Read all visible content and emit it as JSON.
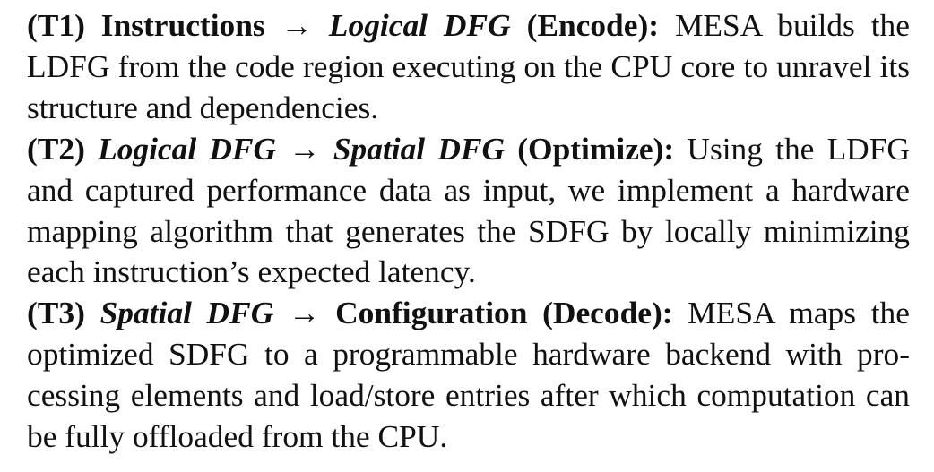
{
  "tasks": [
    {
      "label": "(T1)",
      "heading_a": "Instructions",
      "arrow": "→",
      "heading_b": "Logical DFG",
      "heading_tail": "(Encode):",
      "body": "MESA builds the LDFG from the code region executing on the CPU core to unravel its structure and dependencies."
    },
    {
      "label": "(T2)",
      "heading_a": "Logical DFG",
      "arrow": "→",
      "heading_b": "Spatial DFG",
      "heading_tail": "(Optimize):",
      "body": "Using the LDFG and captured performance data as input, we implement a hardware mapping algorithm that generates the SDFG by locally minimizing each instruction’s expected latency."
    },
    {
      "label": "(T3)",
      "heading_a": "Spatial DFG",
      "arrow": "→",
      "heading_b": "Configuration (Decode):",
      "body": "MESA maps the optimized SDFG to a programmable hardware backend with pro­cessing elements and load/store entries after which computation can be fully offloaded from the CPU."
    }
  ]
}
